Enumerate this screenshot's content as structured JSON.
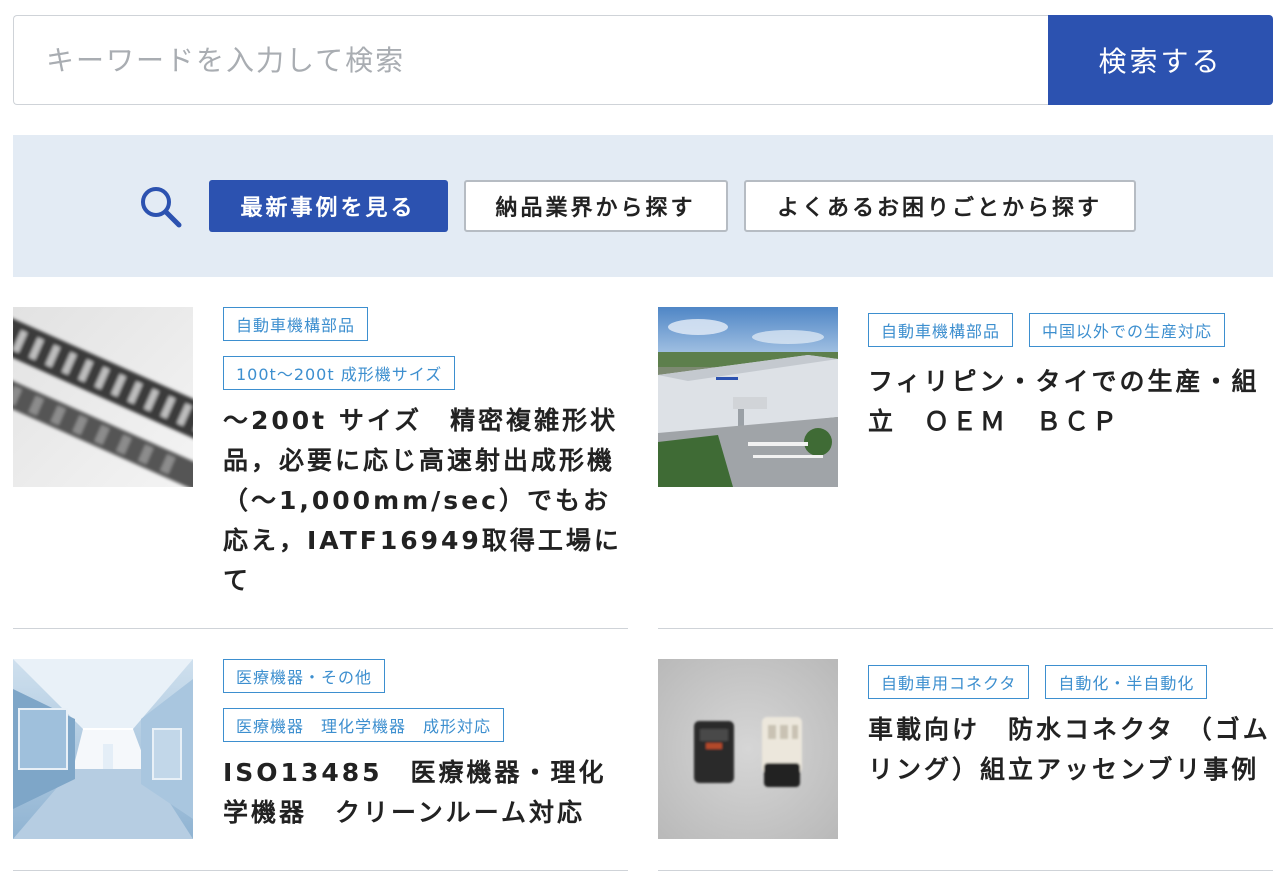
{
  "search": {
    "placeholder": "キーワードを入力して検索",
    "button_label": "検索する"
  },
  "filters": {
    "tabs": [
      {
        "label": "最新事例を見る",
        "active": true
      },
      {
        "label": "納品業界から探す",
        "active": false
      },
      {
        "label": "よくあるお困りごとから探す",
        "active": false
      }
    ]
  },
  "cases": [
    {
      "tags": [
        "自動車機構部品",
        "100t〜200t 成形機サイズ"
      ],
      "title": "〜200t サイズ　精密複雑形状品，必要に応じ高速射出成形機（〜1,000mm/sec）でもお応え，IATF16949取得工場にて",
      "image": "black-plastic-chain-part-photo"
    },
    {
      "tags": [
        "自動車機構部品",
        "中国以外での生産対応"
      ],
      "title": "フィリピン・タイでの生産・組立　ＯＥＭ　ＢＣＰ",
      "image": "factory-aerial-photo"
    },
    {
      "tags": [
        "医療機器・その他",
        "医療機器　理化学機器　成形対応"
      ],
      "title": "ISO13485　医療機器・理化学機器　クリーンルーム対応",
      "image": "clean-room-corridor-photo"
    },
    {
      "tags": [
        "自動車用コネクタ",
        "自動化・半自動化"
      ],
      "title": "車載向け　防水コネクタ （ゴムリング）組立アッセンブリ事例",
      "image": "connector-parts-photo"
    }
  ],
  "colors": {
    "accent": "#2c52b0",
    "tag": "#3d8fcf",
    "panel": "#e3ebf4"
  }
}
